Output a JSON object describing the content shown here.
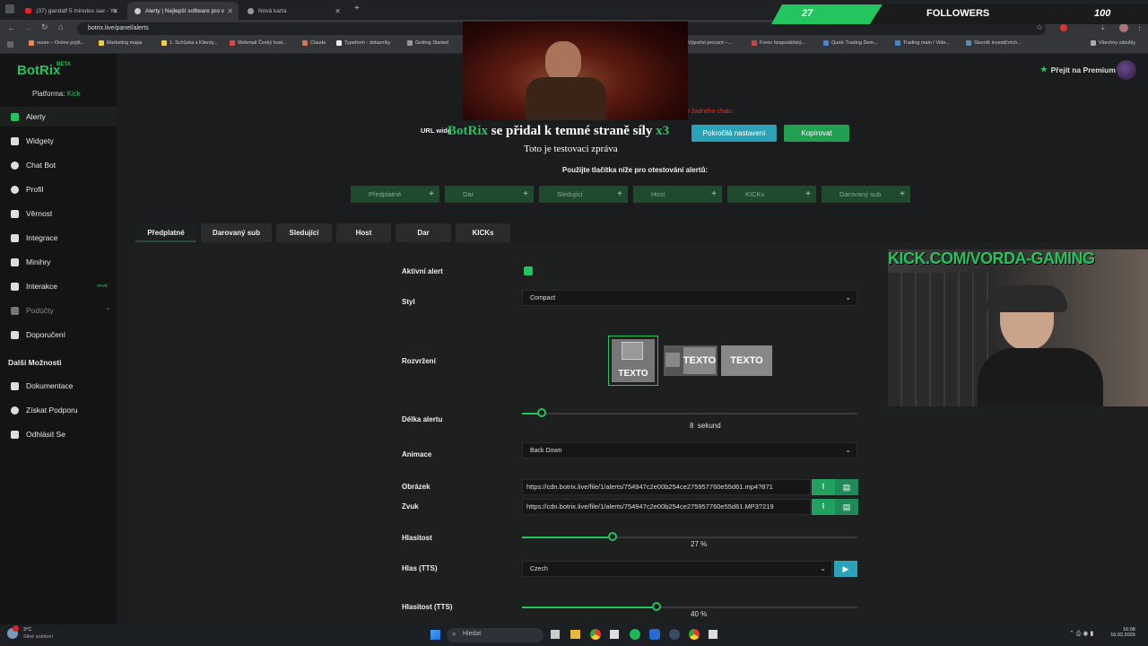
{
  "browser": {
    "tabs": [
      {
        "title": "(37) gandalf 5 minutes sax - Yo"
      },
      {
        "title": "Alerty | Nejlepší software pro v"
      },
      {
        "title": "Nová karta"
      }
    ],
    "url": "botrix.live/panel/alerts",
    "bookmarks": [
      "nsure – Online pojiš...",
      "Marketing mapa",
      "1. Schůzka s Klienty...",
      "Webmail Český host...",
      "Claude",
      "Typeform - dotazníky",
      "Getting Started",
      "Výpočet procent –...",
      "Forex hospodářský...",
      "Quick Trading Dem...",
      "Trading main / Vide...",
      "Slovník investičních...",
      "Všechny záložky"
    ]
  },
  "overlay": {
    "followers_count": "27",
    "followers_label": "FOLLOWERS",
    "followers_goal": "100",
    "alert_brand": "BotRix",
    "alert_message": " se přidal k temné straně síly ",
    "alert_multiplier": "x3",
    "alert_subtext": "Toto je testovací zpráva",
    "webcam_banner": "KICK.COM/VORDA-GAMING"
  },
  "app": {
    "logo": "BotRix",
    "logo_beta": "BETA",
    "premium": "Přejít na Premium",
    "platform_label": "Platforma: ",
    "platform_value": "Kick",
    "nav": [
      {
        "label": "Alerty",
        "icon": "warning-icon"
      },
      {
        "label": "Widgety",
        "icon": "grid-icon"
      },
      {
        "label": "Chat Bot",
        "icon": "chat-icon"
      },
      {
        "label": "Profil",
        "icon": "profile-icon"
      },
      {
        "label": "Věrnost",
        "icon": "diamond-icon"
      },
      {
        "label": "Integrace",
        "icon": "puzzle-icon"
      },
      {
        "label": "Minihry",
        "icon": "gamepad-icon"
      },
      {
        "label": "Interakce",
        "icon": "music-icon",
        "badge": "nové"
      },
      {
        "label": "Podúčty",
        "icon": "users-icon"
      },
      {
        "label": "Doporučení",
        "icon": "referral-icon"
      }
    ],
    "more_header": "Další Možnosti",
    "more": [
      {
        "label": "Dokumentace",
        "icon": "doc-icon"
      },
      {
        "label": "Získat Podporu",
        "icon": "help-icon"
      },
      {
        "label": "Odhlásit Se",
        "icon": "logout-icon"
      }
    ],
    "url_widget_label": "URL widg",
    "error_text": "o žádného chatu",
    "advanced_button": "Pokročilá nastavení",
    "copy_button": "Kopírovat",
    "test_instructions": "Použijte tlačítka níže pro otestování alertů:",
    "test_buttons": [
      "Předplatné",
      "Dar",
      "Sledující",
      "Host",
      "KICKs",
      "Darovaný sub"
    ],
    "tabs": [
      "Předplatné",
      "Darovaný sub",
      "Sledující",
      "Host",
      "Dar",
      "KICKs"
    ],
    "form": {
      "active_label": "Aktivní alert",
      "style_label": "Styl",
      "style_value": "Compact",
      "layout_label": "Rozvržení",
      "layout_text": "TEXTO",
      "length_label": "Délka alertu",
      "length_value": "8",
      "length_unit": "sekund",
      "length_fraction": 0.06,
      "animation_label": "Animace",
      "animation_value": "Back Down",
      "image_label": "Obrázek",
      "image_url": "https://cdn.botrix.live/file/1/alerts/754947c2e00b254ce275957760e55d61.mp4?871",
      "sound_label": "Zvuk",
      "sound_url": "https://cdn.botrix.live/file/1/alerts/754947c2e00b254ce275957760e55d61.MP3?219",
      "volume_label": "Hlasitost",
      "volume_value": "27",
      "volume_unit": "%",
      "volume_fraction": 0.27,
      "tts_voice_label": "Hlas (TTS)",
      "tts_voice_value": "Czech",
      "tts_volume_label": "Hlasitost (TTS)",
      "tts_volume_value": "40",
      "tts_volume_unit": "%",
      "tts_volume_fraction": 0.4
    }
  },
  "taskbar": {
    "weather_temp": "3°C",
    "weather_desc": "Silné sněžení",
    "search_placeholder": "Hledat",
    "time": "16:08",
    "date": "16.02.2026"
  },
  "colors": {
    "accent": "#22c55e",
    "button_blue": "#2aa3b8"
  }
}
